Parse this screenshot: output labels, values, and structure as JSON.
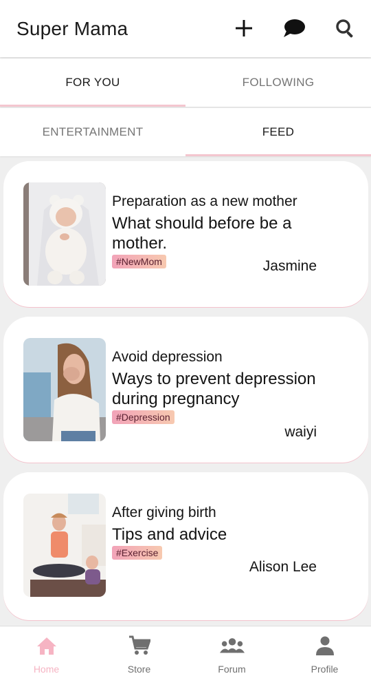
{
  "app": {
    "title": "Super Mama"
  },
  "toolbar": {
    "icons": [
      "plus-icon",
      "chat-bubble-icon",
      "search-icon"
    ]
  },
  "tabs_primary": [
    {
      "label": "FOR YOU",
      "active": true
    },
    {
      "label": "FOLLOWING",
      "active": false
    }
  ],
  "tabs_secondary": [
    {
      "label": "ENTERTAINMENT",
      "active": false
    },
    {
      "label": "FEED",
      "active": true
    }
  ],
  "posts": [
    {
      "category": "Preparation as a new mother",
      "title": "What should before be a mother.",
      "tag": "#NewMom",
      "author": "Jasmine",
      "image": "baby-photo"
    },
    {
      "category": "Avoid depression",
      "title": "Ways to prevent depression during pregnancy",
      "tag": "#Depression",
      "author": "waiyi",
      "image": "stressed-woman-photo"
    },
    {
      "category": "After giving birth",
      "title": "Tips and advice",
      "tag": "#Exercise",
      "author": "Alison Lee",
      "image": "mother-yoga-baby-photo"
    }
  ],
  "bottom_nav": [
    {
      "label": "Home",
      "icon": "home-icon",
      "active": true
    },
    {
      "label": "Store",
      "icon": "cart-icon",
      "active": false
    },
    {
      "label": "Forum",
      "icon": "group-icon",
      "active": false
    },
    {
      "label": "Profile",
      "icon": "person-icon",
      "active": false
    }
  ],
  "colors": {
    "accent": "#f6b4c3",
    "tag_start": "#f2a3b8",
    "tag_end": "#f7c9b0",
    "background": "#efefef"
  }
}
